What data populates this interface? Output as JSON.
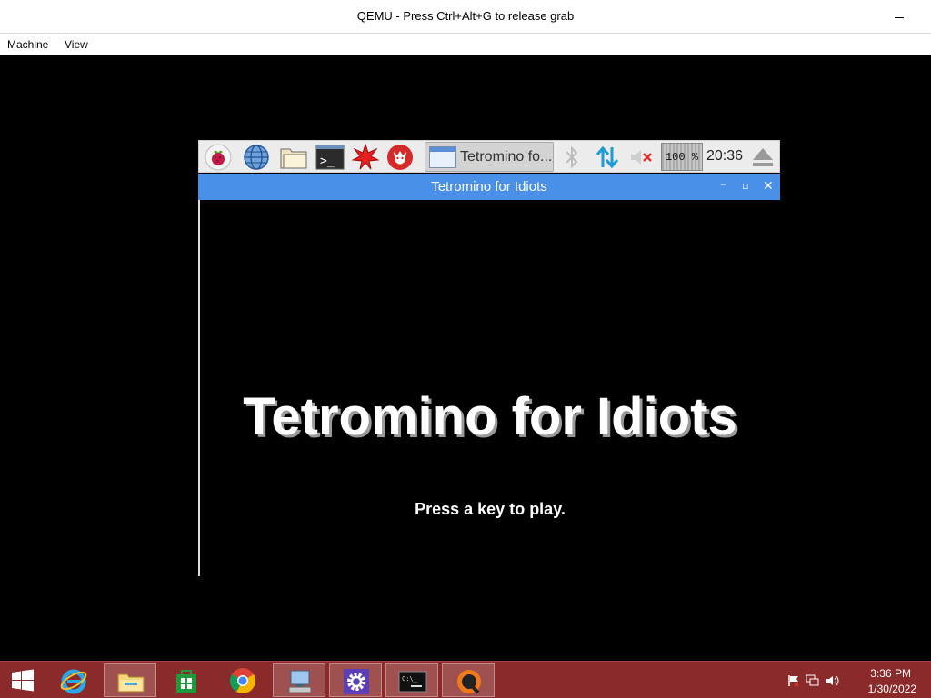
{
  "host": {
    "title": "QEMU - Press Ctrl+Alt+G to release grab",
    "menu": [
      "Machine",
      "View"
    ]
  },
  "rpi_panel": {
    "icons": [
      "raspberry-menu-icon",
      "web-browser-icon",
      "file-manager-icon",
      "terminal-icon",
      "mathematica-icon",
      "wolfram-icon"
    ],
    "task_button_label": "Tetromino fo...",
    "cpu_label": "100 %",
    "clock": "20:36"
  },
  "game_window": {
    "title": "Tetromino for Idiots",
    "heading": "Tetromino for Idiots",
    "prompt": "Press a key to play."
  },
  "win_taskbar": {
    "time": "3:36 PM",
    "date": "1/30/2022",
    "accent": "#8a2a2a"
  }
}
